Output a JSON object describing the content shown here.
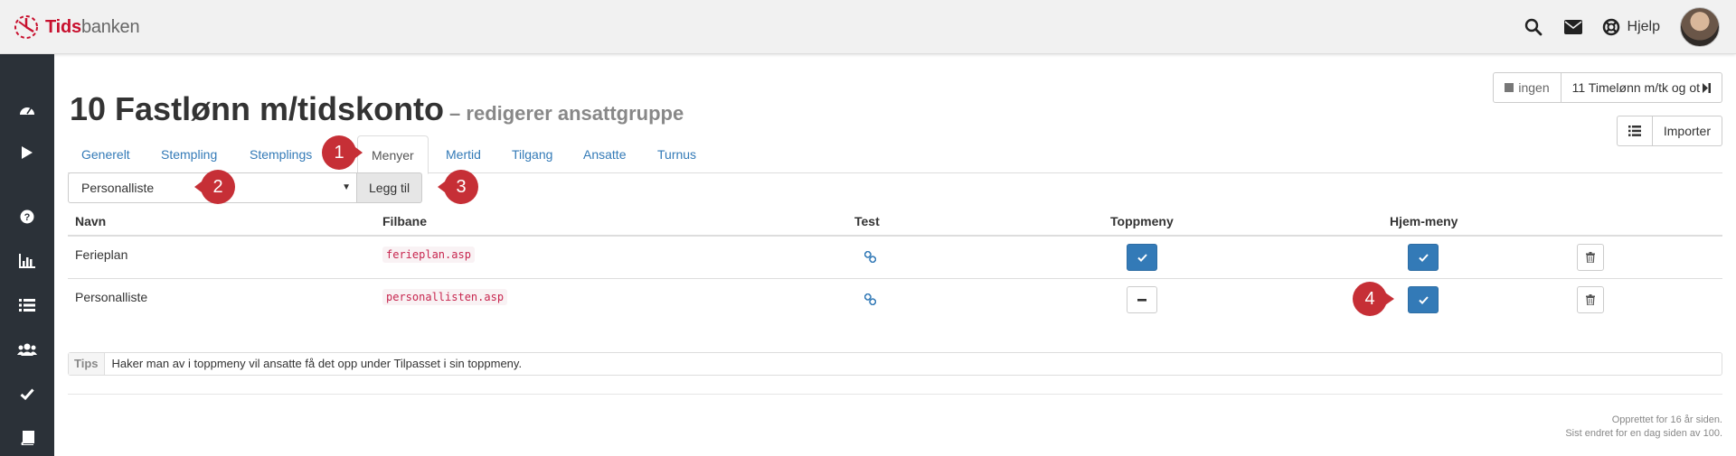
{
  "brand": {
    "part1": "Tids",
    "part2": "banken"
  },
  "header": {
    "help_label": "Hjelp"
  },
  "page": {
    "title": "10 Fastlønn m/tidskonto",
    "subtitle": "– redigerer ansattgruppe"
  },
  "nav_buttons": {
    "prev_label": "ingen",
    "next_label": "11 Timelønn m/tk og ot"
  },
  "actions": {
    "import_label": "Importer"
  },
  "tabs": [
    {
      "label": "Generelt"
    },
    {
      "label": "Stempling"
    },
    {
      "label": "Stemplings"
    },
    {
      "label": "Menyer"
    },
    {
      "label": "Mertid"
    },
    {
      "label": "Tilgang"
    },
    {
      "label": "Ansatte"
    },
    {
      "label": "Turnus"
    }
  ],
  "add_row": {
    "selected": "Personalliste",
    "add_label": "Legg til"
  },
  "table": {
    "headers": {
      "name": "Navn",
      "file": "Filbane",
      "test": "Test",
      "top": "Toppmeny",
      "home": "Hjem-meny"
    },
    "rows": [
      {
        "name": "Ferieplan",
        "file": "ferieplan.asp",
        "top_menu": true,
        "home_menu": true
      },
      {
        "name": "Personalliste",
        "file": "personallisten.asp",
        "top_menu": false,
        "home_menu": true
      }
    ]
  },
  "tips": {
    "label": "Tips",
    "text": "Haker man av i toppmeny vil ansatte få det opp under Tilpasset i sin toppmeny."
  },
  "footer": {
    "created": "Opprettet for 16 år siden.",
    "modified": "Sist endret for en dag siden av 100."
  },
  "callouts": [
    "1",
    "2",
    "3",
    "4"
  ],
  "colors": {
    "primary": "#337ab7",
    "brand_red": "#c8102e",
    "callout_red": "#c62f36",
    "sidebar": "#2b3138"
  }
}
